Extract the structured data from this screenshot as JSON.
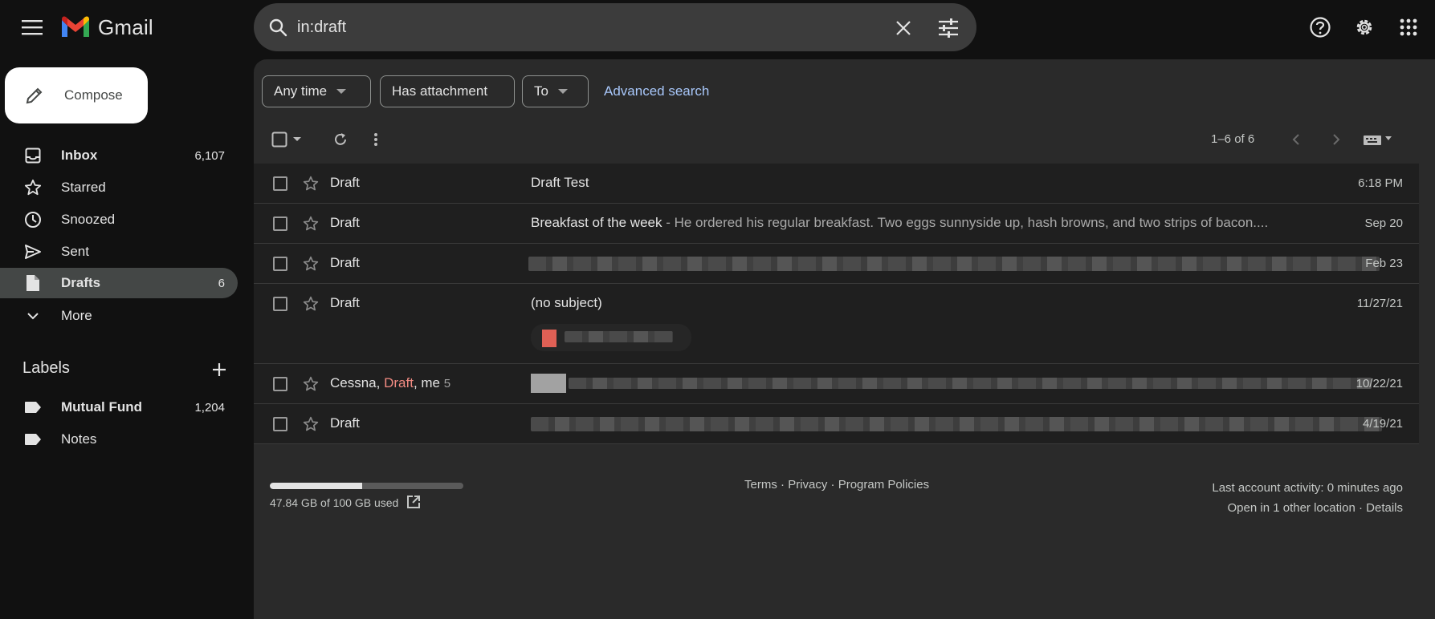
{
  "app": {
    "name": "Gmail"
  },
  "search": {
    "value": "in:draft"
  },
  "compose": {
    "label": "Compose"
  },
  "sidebar": {
    "items": [
      {
        "label": "Inbox",
        "count": "6,107",
        "icon": "inbox-icon"
      },
      {
        "label": "Starred",
        "count": "",
        "icon": "star-icon"
      },
      {
        "label": "Snoozed",
        "count": "",
        "icon": "clock-icon"
      },
      {
        "label": "Sent",
        "count": "",
        "icon": "send-icon"
      },
      {
        "label": "Drafts",
        "count": "6",
        "icon": "draft-file-icon"
      },
      {
        "label": "More",
        "count": "",
        "icon": "chevron-down-icon"
      }
    ],
    "labels_header": "Labels",
    "labels": [
      {
        "label": "Mutual Fund",
        "count": "1,204"
      },
      {
        "label": "Notes",
        "count": ""
      }
    ]
  },
  "filters": {
    "any_time": "Any time",
    "has_attachment": "Has attachment",
    "to": "To",
    "advanced": "Advanced search"
  },
  "toolbar": {
    "page_info": "1–6 of 6"
  },
  "messages": [
    {
      "sender": "Draft",
      "subject": "Draft Test",
      "snippet": "",
      "date": "6:18 PM"
    },
    {
      "sender": "Draft",
      "subject": "Breakfast of the week",
      "snippet": " - He ordered his regular breakfast. Two eggs sunnyside up, hash browns, and two strips of bacon....",
      "date": "Sep 20"
    },
    {
      "sender": "Draft",
      "subject": "",
      "snippet": "",
      "date": "Feb 23"
    },
    {
      "sender": "Draft",
      "subject": "(no subject)",
      "snippet": "",
      "date": "11/27/21"
    },
    {
      "sender_prefix": "Cessna, ",
      "sender": "Draft",
      "sender_suffix": ", me",
      "thread_count": "5",
      "subject": "",
      "snippet": "",
      "date": "10/22/21"
    },
    {
      "sender": "Draft",
      "subject": "",
      "snippet": "",
      "date": "4/19/21"
    }
  ],
  "footer": {
    "storage_text": "47.84 GB of 100 GB used",
    "storage_used_fraction": 0.4784,
    "terms": "Terms",
    "privacy": "Privacy",
    "policies": "Program Policies",
    "sep": " · ",
    "activity": "Last account activity: 0 minutes ago",
    "open_in": "Open in 1 other location",
    "details": "Details"
  },
  "colors": {
    "draft_red": "#f28b82",
    "link_blue": "#a8c7fa",
    "active_nav": "#444746"
  }
}
